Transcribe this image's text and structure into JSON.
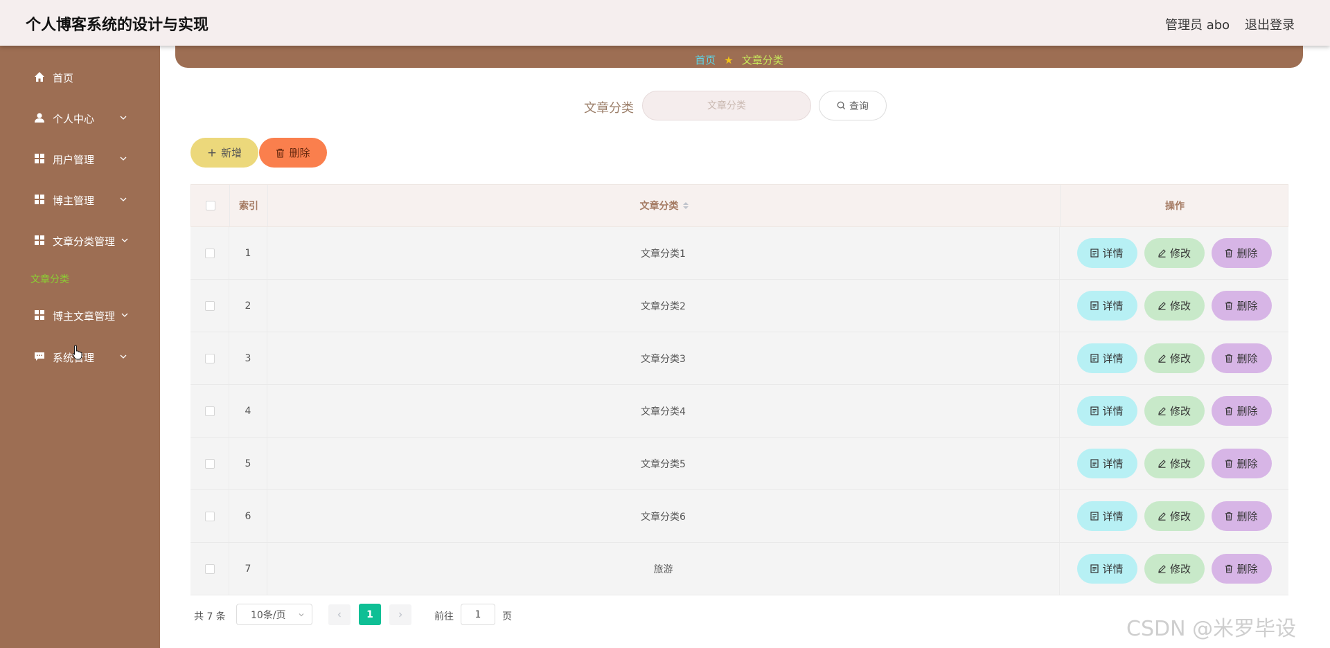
{
  "header": {
    "title": "个人博客系统的设计与实现",
    "user": "管理员 abo",
    "logout": "退出登录"
  },
  "sidebar": {
    "items": [
      {
        "label": "首页",
        "icon": "home-icon"
      },
      {
        "label": "个人中心",
        "icon": "user-icon"
      },
      {
        "label": "用户管理",
        "icon": "grid-icon"
      },
      {
        "label": "博主管理",
        "icon": "grid-icon"
      },
      {
        "label": "文章分类管理",
        "icon": "grid-icon"
      },
      {
        "label": "博主文章管理",
        "icon": "grid-icon"
      },
      {
        "label": "系统管理",
        "icon": "chat-icon"
      }
    ],
    "active_sub": "文章分类"
  },
  "breadcrumb": {
    "home": "首页",
    "current": "文章分类"
  },
  "search": {
    "label": "文章分类",
    "placeholder": "文章分类",
    "button": "查询"
  },
  "actions": {
    "add": "新增",
    "delete": "删除"
  },
  "table": {
    "headers": {
      "index": "索引",
      "category": "文章分类",
      "ops": "操作"
    },
    "rows": [
      {
        "index": "1",
        "category": "文章分类1"
      },
      {
        "index": "2",
        "category": "文章分类2"
      },
      {
        "index": "3",
        "category": "文章分类3"
      },
      {
        "index": "4",
        "category": "文章分类4"
      },
      {
        "index": "5",
        "category": "文章分类5"
      },
      {
        "index": "6",
        "category": "文章分类6"
      },
      {
        "index": "7",
        "category": "旅游"
      }
    ],
    "op_labels": {
      "detail": "详情",
      "edit": "修改",
      "remove": "删除"
    }
  },
  "pagination": {
    "total": "共 7 条",
    "page_size": "10条/页",
    "current": "1",
    "goto": "前往",
    "goto_value": "1",
    "page_suffix": "页"
  },
  "watermark": "CSDN @米罗毕设",
  "colors": {
    "sidebar": "#9d6e53",
    "accent_green": "#0fbf95",
    "add_btn": "#ecd87b",
    "delete_btn": "#fa7f4d"
  }
}
